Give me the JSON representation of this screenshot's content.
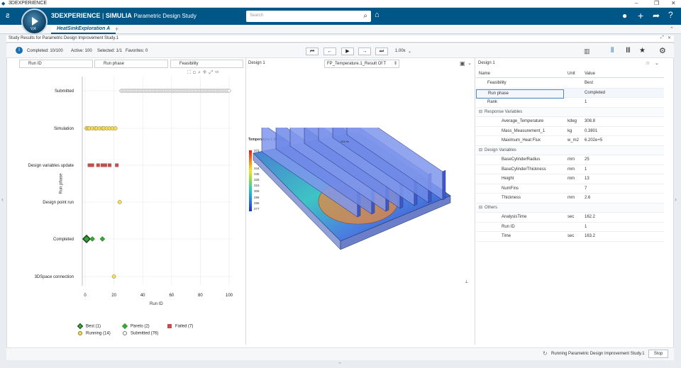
{
  "window": {
    "title": "3DEXPERIENCE"
  },
  "topbar": {
    "brand_bold": "3DEXPERIENCE",
    "brand_sep": " | ",
    "brand_app": "SIMULIA",
    "brand_module": "Parametric Design Study",
    "compass_version": "V,R",
    "search_placeholder": "Search",
    "colors": {
      "bar": "#005686",
      "accent": "#005686"
    }
  },
  "tabs": [
    {
      "label": "HeatSinkExploration A"
    }
  ],
  "panel": {
    "title": "Study Results for Parametric Design Improvement Study.1"
  },
  "status": {
    "completed": "Completed: 10/100",
    "active": "Active: 100",
    "selected": "Selected: 1/1",
    "favorites": "Favorites: 0",
    "speed": "1.00x"
  },
  "filters": {
    "run_id": "Run ID",
    "run_phase": "Run phase",
    "feasibility": "Feasibility"
  },
  "scatter": {
    "y_axis_label": "Run phase",
    "x_axis_label": "Run ID",
    "categories": [
      "Submitted",
      "Simulation",
      "Design variables update",
      "Design point run",
      "Completed",
      "3DSpace connection"
    ],
    "x_ticks": [
      "0",
      "20",
      "40",
      "60",
      "80",
      "100"
    ],
    "legend": [
      {
        "label": "Best (1)",
        "icon": "diamond-dark"
      },
      {
        "label": "Pareto (2)",
        "icon": "diamond-green"
      },
      {
        "label": "Failed (7)",
        "icon": "square-red"
      },
      {
        "label": "Running (14)",
        "icon": "circle-yellow"
      },
      {
        "label": "Submitted (76)",
        "icon": "circle-white"
      }
    ],
    "colors": {
      "best": "#1f4a1f",
      "pareto": "#3aa33a",
      "failed": "#c0504d",
      "running": "#f3dd63",
      "submitted": "#ffffff"
    }
  },
  "chart_data": {
    "type": "scatter",
    "xlabel": "Run ID",
    "ylabel": "Run phase",
    "xlim": [
      0,
      100
    ],
    "categories": [
      "Submitted",
      "Simulation",
      "Design variables update",
      "Design point run",
      "Completed",
      "3DSpace connection"
    ],
    "series": [
      {
        "name": "Best (1)",
        "category": "Completed",
        "x": [
          1
        ]
      },
      {
        "name": "Pareto (2)",
        "category": "Completed",
        "x": [
          5,
          12
        ]
      },
      {
        "name": "Failed (7)",
        "category": "Design variables update",
        "x": [
          3,
          5,
          9,
          12,
          14,
          17,
          22
        ]
      },
      {
        "name": "Running (14)",
        "points": [
          {
            "category": "Simulation",
            "x": [
              1,
              2,
              3,
              5,
              7,
              8,
              10,
              12,
              13,
              15,
              17,
              19,
              21
            ]
          },
          {
            "category": "Design point run",
            "x": [
              24
            ]
          },
          {
            "category": "3DSpace connection",
            "x": [
              20
            ]
          }
        ]
      },
      {
        "name": "Submitted (76)",
        "category": "Submitted",
        "x_range": [
          25,
          100
        ]
      }
    ]
  },
  "middle": {
    "design_label": "Design 1",
    "result_select": "FP_Temperature.1_Result Of T",
    "legend_title": "Temperature 1 (Kdeg)",
    "legend_values": [
      "373",
      "364",
      "354",
      "344",
      "335",
      "325",
      "315",
      "306",
      "296",
      "286",
      "277"
    ],
    "probe_label": "306.9e",
    "probe_label2": "Mass1(e\n313"
  },
  "right": {
    "title": "Design 1",
    "columns": {
      "name": "Name",
      "unit": "Unit",
      "value": "Value"
    },
    "rows": [
      {
        "name": "Feasibility",
        "unit": "",
        "value": "Best",
        "indent": 1
      },
      {
        "name": "Run phase",
        "unit": "",
        "value": "Completed",
        "indent": 1
      },
      {
        "name": "Rank",
        "unit": "",
        "value": "1",
        "indent": 1
      },
      {
        "name": "Response Variables",
        "unit": "",
        "value": "",
        "indent": 0,
        "group": true
      },
      {
        "name": "Average_Temperature",
        "unit": "kdeg",
        "value": "308.8",
        "indent": 2
      },
      {
        "name": "Mass_Measurement_1",
        "unit": "kg",
        "value": "0.3801",
        "indent": 2
      },
      {
        "name": "Maximum_Heat Flux",
        "unit": "w_m2",
        "value": "6.202e+5",
        "indent": 2
      },
      {
        "name": "Design Variables",
        "unit": "",
        "value": "",
        "indent": 0,
        "group": true
      },
      {
        "name": "BaseCylinderRadius",
        "unit": "mm",
        "value": "25",
        "indent": 2
      },
      {
        "name": "BaseCylinderThickness",
        "unit": "mm",
        "value": "1",
        "indent": 2
      },
      {
        "name": "Height",
        "unit": "mm",
        "value": "13",
        "indent": 2
      },
      {
        "name": "NumFins",
        "unit": "",
        "value": "7",
        "indent": 2
      },
      {
        "name": "Thickness",
        "unit": "mm",
        "value": "2.6",
        "indent": 2
      },
      {
        "name": "Others",
        "unit": "",
        "value": "",
        "indent": 0,
        "group": true
      },
      {
        "name": "AnalysisTime",
        "unit": "sec",
        "value": "162.2",
        "indent": 2
      },
      {
        "name": "Run ID",
        "unit": "",
        "value": "1",
        "indent": 2
      },
      {
        "name": "Time",
        "unit": "sec",
        "value": "163.2",
        "indent": 2
      }
    ]
  },
  "footer": {
    "status": "Running Parametric Design Improvement Study.1",
    "stop": "Stop"
  }
}
